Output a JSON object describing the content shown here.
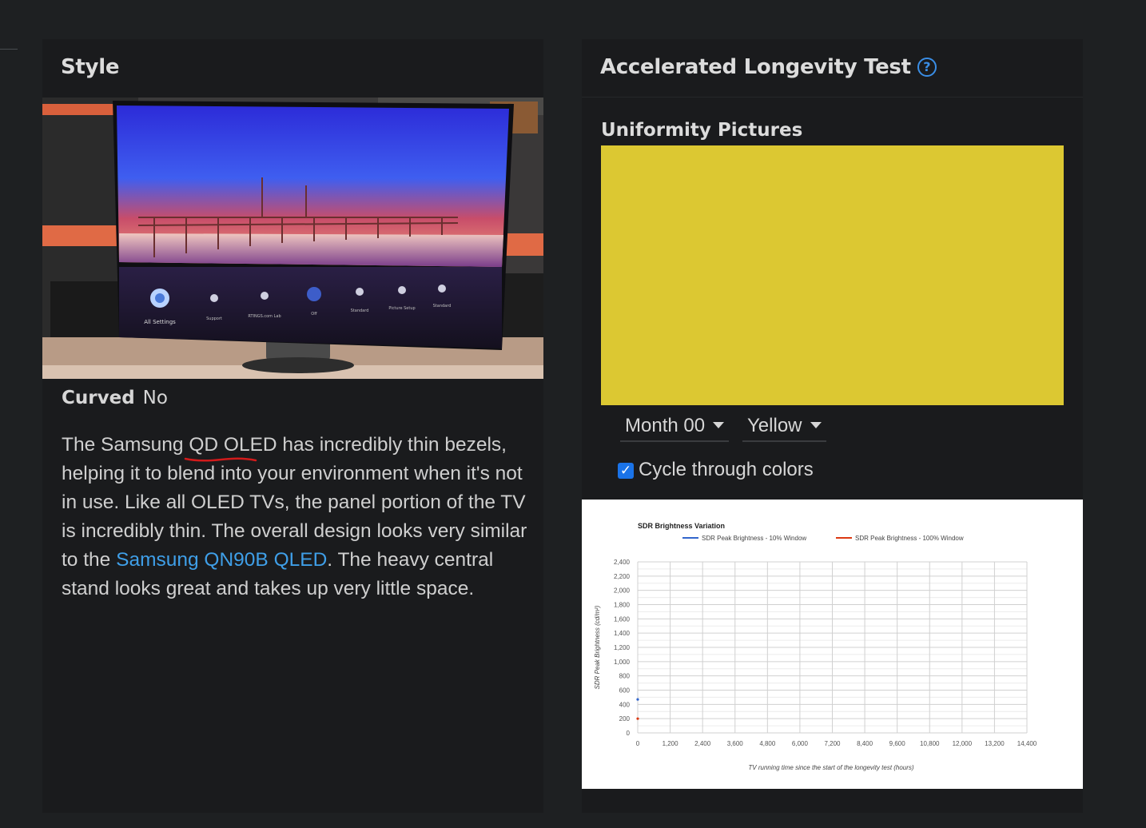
{
  "style_panel": {
    "title": "Style",
    "curved_label": "Curved",
    "curved_value": "No",
    "desc_part1": "The Samsung ",
    "desc_squiggle": "QD OLED",
    "desc_part2": " has incredibly thin bezels, helping it to blend into your environment when it's not in use. Like all OLED TVs, the panel portion of the TV is incredibly thin. The overall design looks very similar to the ",
    "desc_link": "Samsung QN90B QLED",
    "desc_part3": ". The heavy central stand looks great and takes up very little space.",
    "tv_menu_items": [
      "All Settings",
      "Support",
      "RTINGS.com Lab",
      "Off",
      "Standard",
      "Picture Setup",
      "Standard"
    ]
  },
  "longevity_panel": {
    "title": "Accelerated Longevity Test",
    "help_icon": "?",
    "uniformity_label": "Uniformity Pictures",
    "month_select": "Month 00",
    "color_select": "Yellow",
    "cycle_label": "Cycle through colors",
    "cycle_checked": true,
    "uniformity_color": "#dcc832"
  },
  "chart_data": {
    "type": "line",
    "title": "SDR Brightness Variation",
    "xlabel": "TV running time since the start of the longevity test (hours)",
    "ylabel": "SDR Peak Brightness (cd/m²)",
    "x_ticks": [
      "0",
      "1,200",
      "2,400",
      "3,600",
      "4,800",
      "6,000",
      "7,200",
      "8,400",
      "9,600",
      "10,800",
      "12,000",
      "13,200",
      "14,400"
    ],
    "y_ticks": [
      "0",
      "200",
      "400",
      "600",
      "800",
      "1,000",
      "1,200",
      "1,400",
      "1,600",
      "1,800",
      "2,000",
      "2,200",
      "2,400"
    ],
    "xlim": [
      0,
      14400
    ],
    "ylim": [
      0,
      2400
    ],
    "legend_position": "top",
    "series": [
      {
        "name": "SDR Peak Brightness - 10% Window",
        "color": "#3366cc",
        "x": [
          0
        ],
        "y": [
          470
        ]
      },
      {
        "name": "SDR Peak Brightness - 100% Window",
        "color": "#dc3912",
        "x": [
          0
        ],
        "y": [
          200
        ]
      }
    ]
  }
}
